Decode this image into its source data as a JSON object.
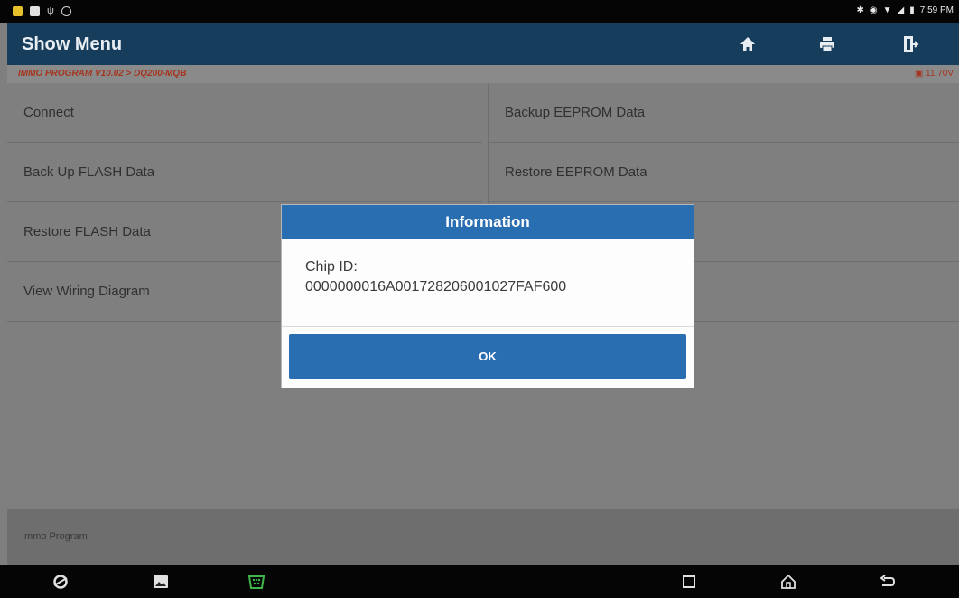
{
  "status_bar": {
    "time": "7:59 PM",
    "left_icons": [
      "notification-yellow-icon",
      "notification-white-icon",
      "usb-icon",
      "circle-icon"
    ],
    "right_icons": [
      "bluetooth-icon",
      "location-icon",
      "wifi-icon",
      "signal-icon",
      "battery-icon"
    ]
  },
  "header": {
    "title": "Show Menu",
    "buttons": [
      "home-icon",
      "print-icon",
      "exit-icon"
    ]
  },
  "breadcrumb": {
    "path": "IMMO PROGRAM V10.02 > DQ200-MQB",
    "voltage": "11.70V"
  },
  "menu": {
    "items": [
      {
        "label": "Connect"
      },
      {
        "label": "Backup EEPROM Data"
      },
      {
        "label": "Back Up FLASH Data"
      },
      {
        "label": "Restore EEPROM Data"
      },
      {
        "label": "Restore FLASH Data"
      },
      {
        "label": ""
      },
      {
        "label": "View Wiring Diagram"
      },
      {
        "label": ""
      }
    ]
  },
  "footer": {
    "label": "Immo Program"
  },
  "dialog": {
    "title": "Information",
    "line1": "Chip ID:",
    "line2": "0000000016A001728206001027FAF600",
    "ok_label": "OK"
  },
  "nav_bar": {
    "icons": [
      "browser-icon",
      "gallery-icon",
      "vci-connector-icon",
      "recent-apps-icon",
      "home-nav-icon",
      "back-icon"
    ]
  },
  "colors": {
    "header_bg": "#173d5c",
    "accent": "#2a6eb2",
    "breadcrumb_text": "#a5351e",
    "connector_green": "#3fb54a"
  }
}
